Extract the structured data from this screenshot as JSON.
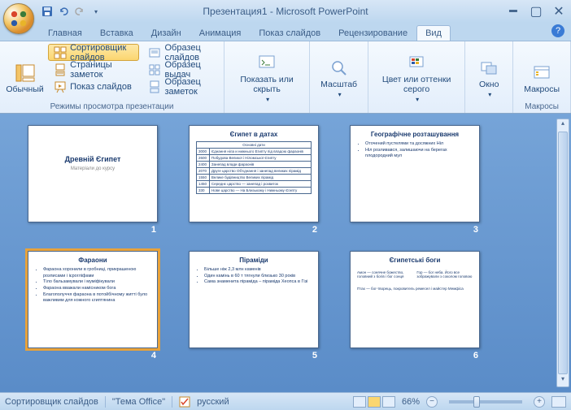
{
  "title": "Презентация1 - Microsoft PowerPoint",
  "tabs": {
    "home": "Главная",
    "insert": "Вставка",
    "design": "Дизайн",
    "animation": "Анимация",
    "slideshow": "Показ слайдов",
    "review": "Рецензирование",
    "view": "Вид"
  },
  "ribbon": {
    "group1_label": "Режимы просмотра презентации",
    "normal": "Обычный",
    "sorter": "Сортировщик слайдов",
    "notes": "Страницы заметок",
    "show": "Показ слайдов",
    "master_slide": "Образец слайдов",
    "master_handout": "Образец выдач",
    "master_notes": "Образец заметок",
    "show_hide": "Показать или скрыть",
    "zoom": "Масштаб",
    "color": "Цвет или оттенки серого",
    "window": "Окно",
    "macros": "Макросы",
    "macros_group": "Макросы"
  },
  "slides": [
    {
      "num": "1",
      "title": "Древній Єгипет",
      "subtitle": "Матеріали до курсу"
    },
    {
      "num": "2",
      "title": "Єгипет в датах"
    },
    {
      "num": "3",
      "title": "Географічне розташування",
      "bullets": [
        "Оточений пустелями та досяжних Ніл",
        "Ніл розливався, залишаючи на берегах плодородний мул"
      ]
    },
    {
      "num": "4",
      "title": "Фараони",
      "bullets": [
        "Фараона хоронили в гробниці, прикрашеною розписами і ієрогліфами",
        "Тіло бальзамували і муміфікували",
        "Фараона вважали намісником бога",
        "Благополуччя фараона в потойбічному житті було важливим для кожного єгиптянина"
      ]
    },
    {
      "num": "5",
      "title": "Піраміди",
      "bullets": [
        "Більше ніж 2,3 млн каменів",
        "Один камінь в 60 т тягнули близько 30 років",
        "Сама знаменита піраміда – піраміда Хеопса в Гізі"
      ]
    },
    {
      "num": "6",
      "title": "Єгипетські боги"
    }
  ],
  "status": {
    "mode": "Сортировщик слайдов",
    "theme": "\"Тема Office\"",
    "lang": "русский",
    "zoom": "66%"
  }
}
